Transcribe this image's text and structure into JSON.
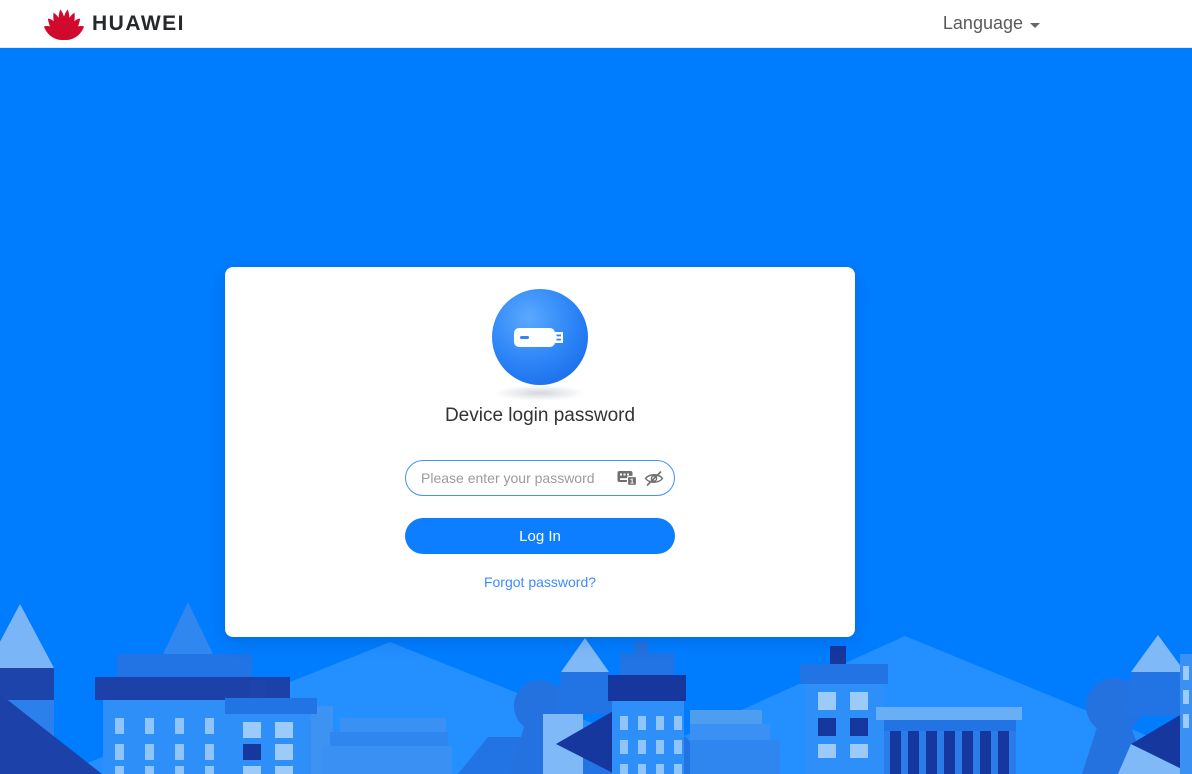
{
  "header": {
    "brand_wordmark": "HUAWEI",
    "language": {
      "label": "Language"
    }
  },
  "login": {
    "title": "Device login password",
    "password": {
      "placeholder": "Please enter your password",
      "value": ""
    },
    "log_in_button": "Log In",
    "forgot_password_link": "Forgot password?"
  },
  "icons": {
    "huawei_flower": "huawei-logo-icon",
    "language_caret": "chevron-down-icon",
    "device": "usb-modem-icon",
    "keyboard": "onscreen-keyboard-icon",
    "keyboard_badge": "1",
    "eye": "password-hidden-eye-icon"
  },
  "colors": {
    "page_background": "#007dff",
    "brand_red": "#cf0a2c",
    "button_blue": "#0d7eff",
    "link_blue": "#3d8bff",
    "title_text": "#333333",
    "skyline_navy": "#16379e",
    "skyline_medium": "#2273e3",
    "skyline_bright": "#2e8ff8",
    "skyline_light": "#7fb9f8"
  }
}
